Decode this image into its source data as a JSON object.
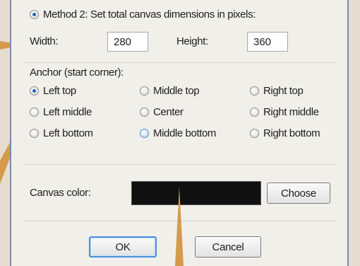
{
  "method": {
    "label": "Method 2: Set total canvas dimensions in pixels:",
    "selected": true
  },
  "size": {
    "width_label": "Width:",
    "width_value": "280",
    "height_label": "Height:",
    "height_value": "360"
  },
  "anchor": {
    "title": "Anchor (start corner):",
    "options": [
      {
        "label": "Left top",
        "checked": true
      },
      {
        "label": "Middle top",
        "checked": false
      },
      {
        "label": "Right top",
        "checked": false
      },
      {
        "label": "Left middle",
        "checked": false
      },
      {
        "label": "Center",
        "checked": false
      },
      {
        "label": "Right middle",
        "checked": false
      },
      {
        "label": "Left bottom",
        "checked": false
      },
      {
        "label": "Middle bottom",
        "checked": false,
        "focused": true
      },
      {
        "label": "Right bottom",
        "checked": false
      }
    ]
  },
  "canvas": {
    "label": "Canvas color:",
    "color": "#101010",
    "choose_label": "Choose"
  },
  "buttons": {
    "ok_label": "OK",
    "cancel_label": "Cancel"
  },
  "colors": {
    "accent": "#2d63b4",
    "callout_arrow": "#d69a4d"
  }
}
